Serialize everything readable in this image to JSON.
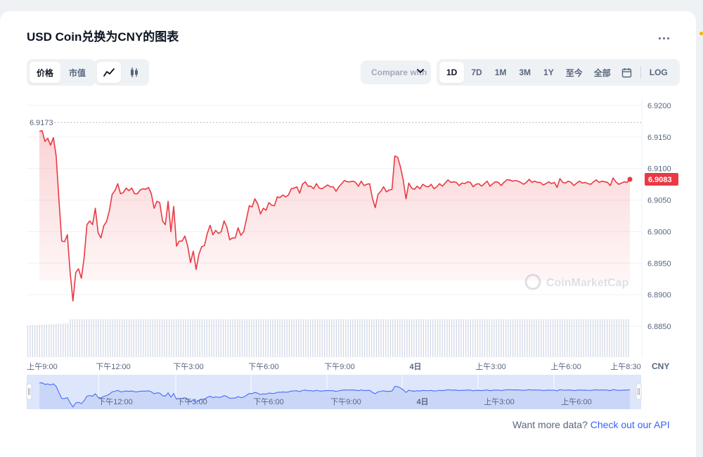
{
  "header": {
    "title": "USD Coin兑换为CNY的图表",
    "more_label": "..."
  },
  "toggle_metric": [
    {
      "label": "价格",
      "active": true
    },
    {
      "label": "市值",
      "active": false
    }
  ],
  "toggle_type": [
    {
      "icon": "line-chart-icon",
      "active": true
    },
    {
      "icon": "candlestick-icon",
      "active": false
    }
  ],
  "compare": {
    "label": "Compare with"
  },
  "ranges": [
    {
      "label": "1D",
      "active": true
    },
    {
      "label": "7D",
      "active": false
    },
    {
      "label": "1M",
      "active": false
    },
    {
      "label": "3M",
      "active": false
    },
    {
      "label": "1Y",
      "active": false
    },
    {
      "label": "至今",
      "active": false
    },
    {
      "label": "全部",
      "active": false
    }
  ],
  "calendar_icon": "calendar-icon",
  "log_label": "LOG",
  "footer": {
    "text": "Want more data?",
    "link": "Check out our API"
  },
  "watermark": {
    "text": "CoinMarketCap"
  },
  "colors": {
    "line": "#ea3943",
    "fill_top": "#fbd9db",
    "navigator_fill": "#dde6fb",
    "navigator_line": "#3861fb",
    "volume": "#cfd6e4",
    "badge": "#ea3943"
  },
  "chart_data": {
    "type": "line",
    "currency_label": "CNY",
    "high_label": "6.9173",
    "last_price_label": "6.9083",
    "last_price": 6.9083,
    "ylim": [
      6.88,
      6.921
    ],
    "y_ticks": [
      "6.9200",
      "6.9150",
      "6.9100",
      "6.9050",
      "6.9000",
      "6.8950",
      "6.8900",
      "6.8850"
    ],
    "x_ticks": [
      "上午9:00",
      "下午12:00",
      "下午3:00",
      "下午6:00",
      "下午9:00",
      "4日",
      "上午3:00",
      "上午6:00",
      "上午8:30"
    ],
    "navigator_ticks": [
      "下午12:00",
      "下午3:00",
      "下午6:00",
      "下午9:00",
      "4日",
      "上午3:00",
      "上午6:00"
    ],
    "grid": true,
    "series": [
      {
        "values": [
          6.9159,
          6.916,
          6.9143,
          6.9148,
          6.9137,
          6.9149,
          6.912,
          6.905,
          6.8985,
          6.8984,
          6.8995,
          6.8935,
          6.889,
          6.8935,
          6.8941,
          6.8926,
          6.8959,
          6.9011,
          6.9017,
          6.9011,
          6.9037,
          6.8998,
          6.899,
          6.9009,
          6.9016,
          6.9033,
          6.9059,
          6.9065,
          6.9076,
          6.906,
          6.9062,
          6.9069,
          6.9065,
          6.9069,
          6.906,
          6.906,
          6.9066,
          6.9068,
          6.9067,
          6.907,
          6.906,
          6.9037,
          6.9048,
          6.9046,
          6.9017,
          6.9011,
          6.9048,
          6.9,
          6.904,
          6.8977,
          6.8985,
          6.8985,
          6.8993,
          6.8977,
          6.8951,
          6.8969,
          6.894,
          6.8964,
          6.8976,
          6.8978,
          6.8997,
          6.901,
          6.8995,
          6.9002,
          6.8997,
          6.9,
          6.9017,
          6.9007,
          6.8987,
          6.899,
          6.899,
          6.9006,
          6.8994,
          6.9,
          6.902,
          6.9041,
          6.9039,
          6.9052,
          6.9044,
          6.9028,
          6.9037,
          6.9034,
          6.9046,
          6.9042,
          6.9041,
          6.9055,
          6.9054,
          6.9058,
          6.9055,
          6.9058,
          6.9068,
          6.9069,
          6.9071,
          6.9061,
          6.9075,
          6.9079,
          6.9072,
          6.9072,
          6.9068,
          6.9076,
          6.9069,
          6.9068,
          6.9071,
          6.9074,
          6.9071,
          6.9071,
          6.9064,
          6.9071,
          6.9076,
          6.9081,
          6.9079,
          6.9079,
          6.908,
          6.9078,
          6.9072,
          6.908,
          6.9073,
          6.9075,
          6.9076,
          6.9053,
          6.9038,
          6.9059,
          6.9064,
          6.9071,
          6.9063,
          6.9066,
          6.9067,
          6.912,
          6.9118,
          6.9103,
          6.9082,
          6.9052,
          6.9077,
          6.9069,
          6.9067,
          6.9072,
          6.9068,
          6.9075,
          6.9072,
          6.9071,
          6.9075,
          6.9068,
          6.9071,
          6.9076,
          6.9072,
          6.9077,
          6.9082,
          6.9078,
          6.9079,
          6.9078,
          6.9073,
          6.9077,
          6.9076,
          6.9079,
          6.9078,
          6.9071,
          6.9075,
          6.9076,
          6.9072,
          6.9076,
          6.908,
          6.9072,
          6.9076,
          6.9079,
          6.9078,
          6.9073,
          6.9078,
          6.9082,
          6.9082,
          6.908,
          6.9081,
          6.908,
          6.9078,
          6.9075,
          6.9078,
          6.9083,
          6.9078,
          6.908,
          6.9078,
          6.9078,
          6.9074,
          6.9076,
          6.9079,
          6.9076,
          6.9078,
          6.907,
          6.9084,
          6.9078,
          6.9077,
          6.908,
          6.9078,
          6.9073,
          6.9077,
          6.908,
          6.9077,
          6.9078,
          6.9076,
          6.9075,
          6.9079,
          6.9082,
          6.9078,
          6.908,
          6.9079,
          6.9078,
          6.9073,
          6.9085,
          6.9079,
          6.9075,
          6.9077,
          6.9079,
          6.9078,
          6.9083
        ]
      }
    ]
  }
}
